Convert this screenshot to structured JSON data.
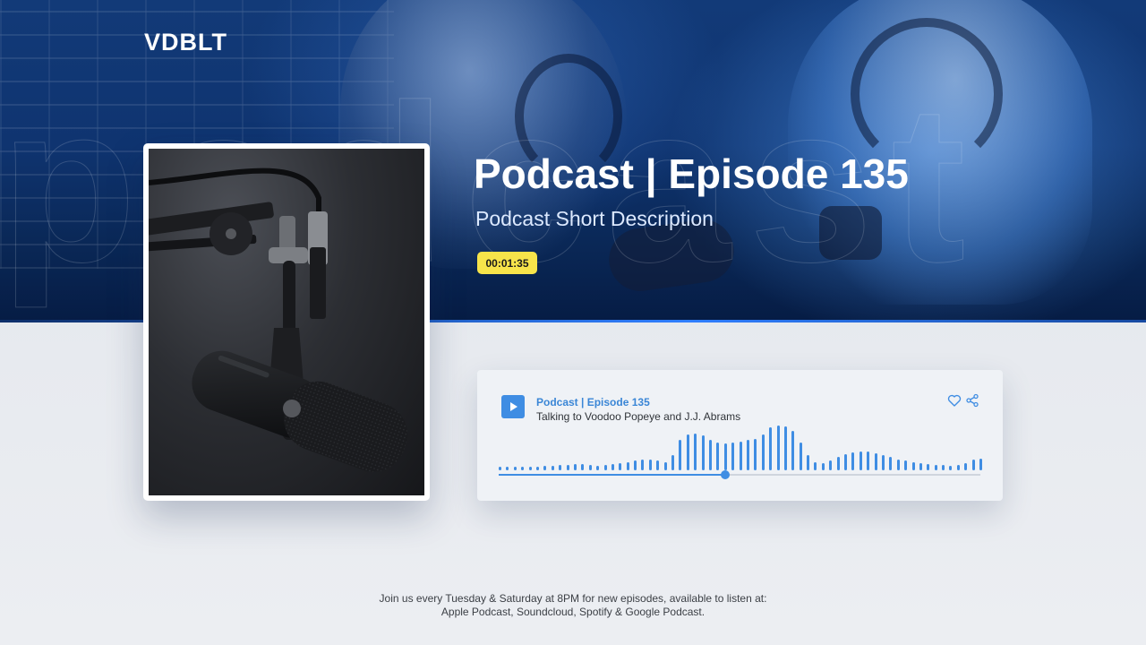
{
  "brand": {
    "logo_text": "VDBLT"
  },
  "banner": {
    "title": "Podcast | Episode 135",
    "subtitle": "Podcast Short Description",
    "timestamp": "00:01:35",
    "timestamp_color": "#f7e44a",
    "background_text": "podcast"
  },
  "cover": {
    "image": "microphone-photo"
  },
  "player": {
    "title": "Podcast | Episode 135",
    "subtitle": "Talking to Voodoo Popeye and J.J. Abrams",
    "play_icon": "play-icon",
    "like_icon": "heart-icon",
    "share_icon": "share-icon",
    "accent_color": "#3f8de3",
    "progress": 0.47,
    "waveform": [
      0.07,
      0.07,
      0.07,
      0.07,
      0.07,
      0.07,
      0.09,
      0.09,
      0.11,
      0.11,
      0.13,
      0.13,
      0.11,
      0.09,
      0.11,
      0.13,
      0.15,
      0.17,
      0.19,
      0.21,
      0.21,
      0.19,
      0.17,
      0.3,
      0.6,
      0.72,
      0.74,
      0.7,
      0.6,
      0.55,
      0.53,
      0.55,
      0.57,
      0.6,
      0.62,
      0.72,
      0.85,
      0.9,
      0.88,
      0.78,
      0.55,
      0.3,
      0.17,
      0.15,
      0.19,
      0.26,
      0.32,
      0.36,
      0.38,
      0.38,
      0.34,
      0.3,
      0.26,
      0.21,
      0.19,
      0.17,
      0.15,
      0.13,
      0.11,
      0.11,
      0.09,
      0.11,
      0.15,
      0.21,
      0.24
    ]
  },
  "footer": {
    "line1": "Join us every Tuesday & Saturday at 8PM for new episodes, available to listen at:",
    "line2": "Apple Podcast, Soundcloud, Spotify & Google Podcast."
  }
}
